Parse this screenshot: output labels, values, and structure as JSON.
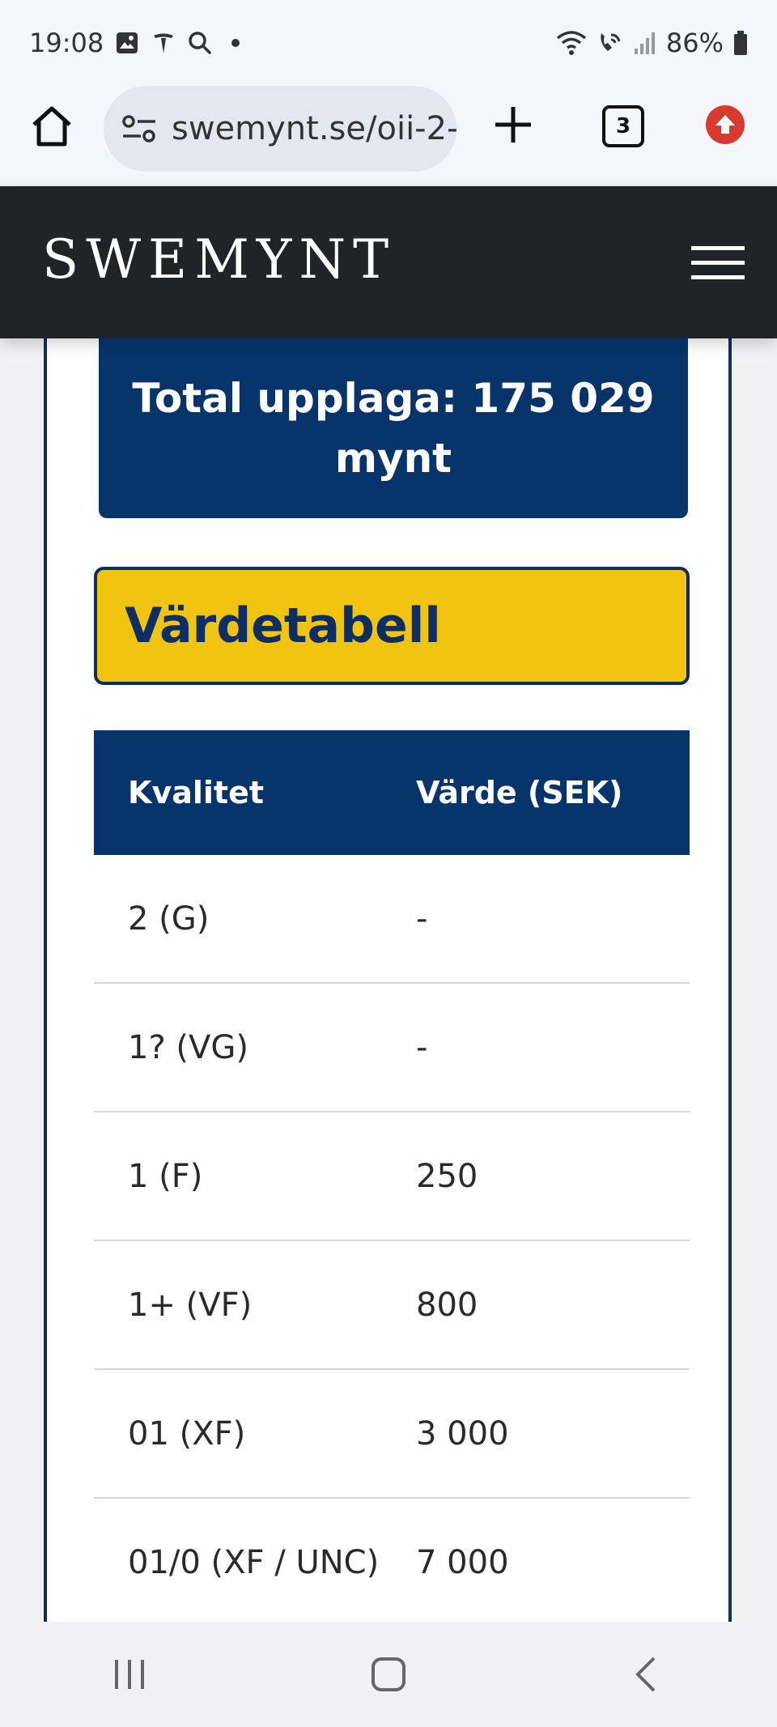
{
  "status": {
    "time": "19:08",
    "battery": "86%"
  },
  "browser": {
    "url": "swemynt.se/oii-2-",
    "tab_count": "3"
  },
  "site": {
    "logo": "SWEMYNT"
  },
  "content": {
    "total_label": "Total upplaga: 175 029 mynt",
    "value_table_heading": "Värdetabell",
    "table": {
      "headers": [
        "Kvalitet",
        "Värde (SEK)"
      ],
      "rows": [
        {
          "grade": "2 (G)",
          "value": "-"
        },
        {
          "grade": "1? (VG)",
          "value": "-"
        },
        {
          "grade": "1 (F)",
          "value": "250"
        },
        {
          "grade": "1+ (VF)",
          "value": "800"
        },
        {
          "grade": "01 (XF)",
          "value": "3 000"
        },
        {
          "grade": "01/0 (XF / UNC)",
          "value": "7 000"
        }
      ]
    }
  },
  "colors": {
    "header_dark": "#222326",
    "navy": "#07346b",
    "yellow": "#f0c410",
    "update_red": "#d83a30"
  },
  "icons": {
    "status": [
      "gallery-icon",
      "tesla-icon",
      "search-icon",
      "wifi-icon",
      "wifi-call-icon",
      "signal-icon",
      "battery-icon"
    ],
    "browser": [
      "home-icon",
      "site-settings-icon",
      "new-tab-icon",
      "tab-switcher-icon",
      "update-icon"
    ],
    "nav": [
      "recent-apps-icon",
      "home-nav-icon",
      "back-icon"
    ]
  }
}
